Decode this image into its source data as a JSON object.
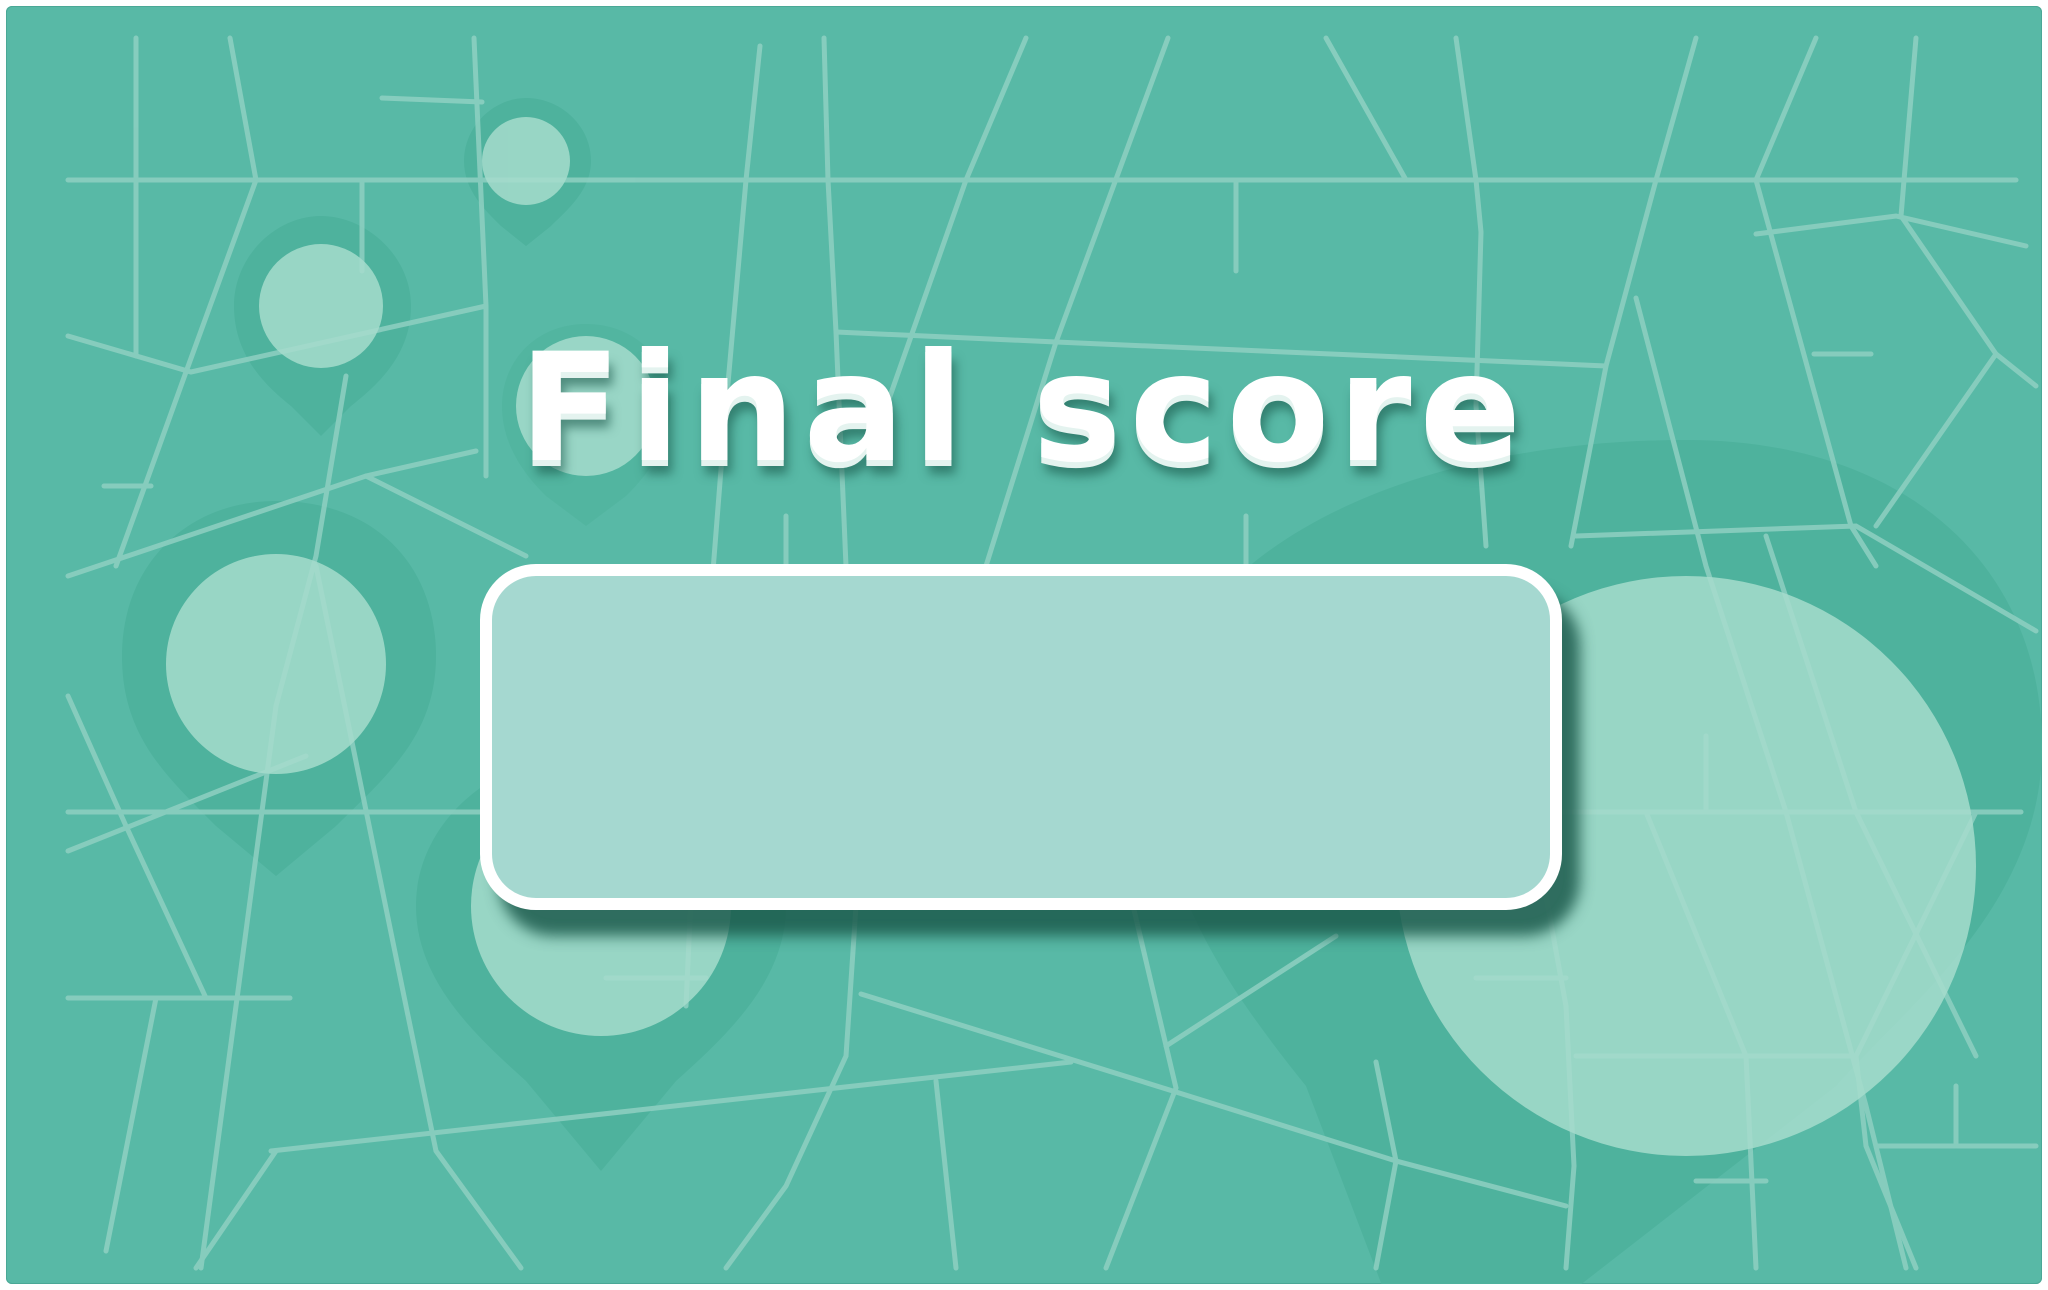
{
  "screen": {
    "title": "Final score",
    "score": ""
  },
  "colors": {
    "background": "#58b9a6",
    "road_lines": "#8fd0c2",
    "pin_dark": "#4bae99",
    "pin_light": "#8fcfbe",
    "panel_fill": "#a5d8d0",
    "panel_border": "#ffffff",
    "title_text": "#ffffff"
  },
  "decorations": {
    "map_background": "city-street-map",
    "pins": [
      "location-pin-icon",
      "location-pin-icon",
      "location-pin-icon",
      "location-pin-icon",
      "location-pin-icon",
      "location-pin-icon"
    ]
  }
}
